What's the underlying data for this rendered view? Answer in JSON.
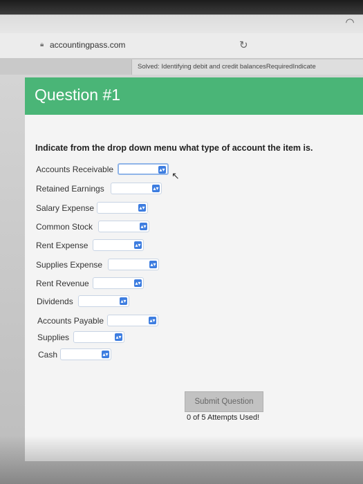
{
  "browser": {
    "url": "accountingpass.com",
    "tab_title": "Solved: Identifying debit and credit balancesRequiredIndicate"
  },
  "question": {
    "title": "Question #1",
    "instruction": "Indicate from the drop down menu what type of account the item is.",
    "items": [
      {
        "label": "Accounts Receivable",
        "value": ""
      },
      {
        "label": "Retained Earnings",
        "value": ""
      },
      {
        "label": "Salary Expense",
        "value": ""
      },
      {
        "label": "Common Stock",
        "value": ""
      },
      {
        "label": "Rent Expense",
        "value": ""
      },
      {
        "label": "Supplies Expense",
        "value": ""
      },
      {
        "label": "Rent Revenue",
        "value": ""
      },
      {
        "label": "Dividends",
        "value": ""
      },
      {
        "label": "Accounts Payable",
        "value": ""
      },
      {
        "label": "Supplies",
        "value": ""
      },
      {
        "label": "Cash",
        "value": ""
      }
    ],
    "submit_label": "Submit Question",
    "attempts": "0 of 5 Attempts Used!"
  },
  "colors": {
    "header_green": "#4ab577",
    "select_arrow_blue": "#3d7de0"
  }
}
